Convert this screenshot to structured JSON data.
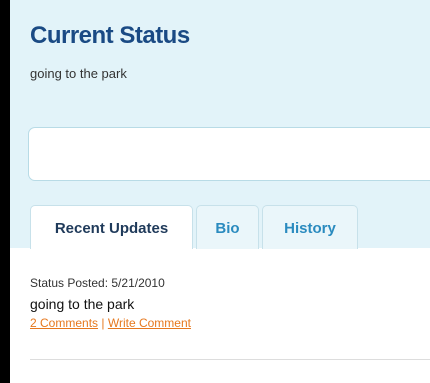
{
  "header": {
    "title": "Current Status",
    "status": "going to the park"
  },
  "update_box": {
    "value": "",
    "placeholder": ""
  },
  "tabs": [
    {
      "label": "Recent Updates",
      "active": true
    },
    {
      "label": "Bio",
      "active": false
    },
    {
      "label": "History",
      "active": false
    }
  ],
  "post": {
    "meta": "Status Posted: 5/21/2010",
    "text": "going to the park",
    "comments_link": "2 Comments",
    "separator": "|",
    "write_link": "Write Comment"
  },
  "colors": {
    "page_background": "#000000",
    "panel_background": "#e2f3f9",
    "title": "#1a4a84",
    "tab_text": "#2a8bbf",
    "link": "#e6781e"
  }
}
